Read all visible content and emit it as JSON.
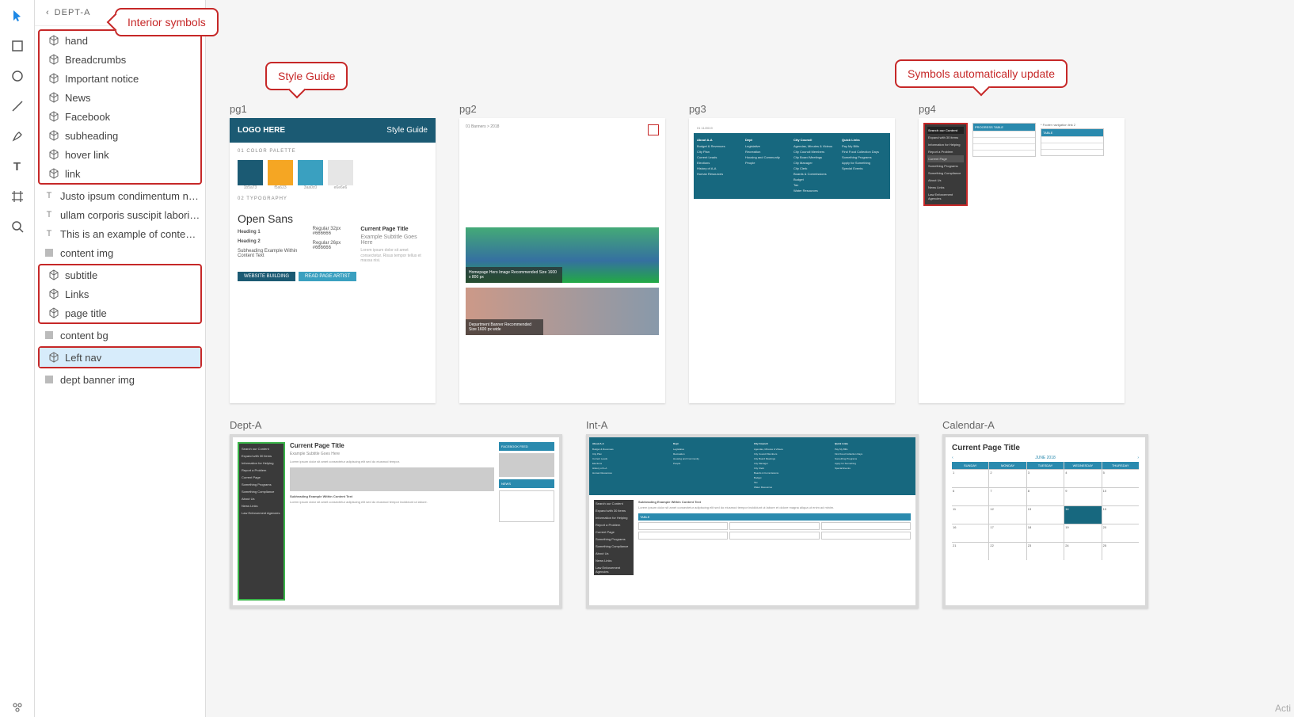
{
  "breadcrumb": {
    "back": "‹",
    "title": "DEPT-A"
  },
  "callouts": {
    "interior_symbols": "Interior symbols",
    "style_guide": "Style Guide",
    "symbols_update": "Symbols automatically update"
  },
  "toolbar": [
    {
      "name": "select-tool",
      "icon": "pointer",
      "active": true
    },
    {
      "name": "rectangle-tool",
      "icon": "square"
    },
    {
      "name": "ellipse-tool",
      "icon": "circle"
    },
    {
      "name": "line-tool",
      "icon": "line"
    },
    {
      "name": "pen-tool",
      "icon": "pen"
    },
    {
      "name": "text-tool",
      "icon": "T"
    },
    {
      "name": "artboard-tool",
      "icon": "crop"
    },
    {
      "name": "zoom-tool",
      "icon": "zoom"
    }
  ],
  "layers": [
    {
      "icon": "symbol",
      "label": "hand",
      "group": 1
    },
    {
      "icon": "symbol",
      "label": "Breadcrumbs",
      "group": 1
    },
    {
      "icon": "symbol",
      "label": "Important notice",
      "group": 1
    },
    {
      "icon": "symbol",
      "label": "News",
      "group": 1
    },
    {
      "icon": "symbol",
      "label": "Facebook",
      "group": 1
    },
    {
      "icon": "symbol",
      "label": "subheading",
      "group": 1
    },
    {
      "icon": "symbol",
      "label": "hover link",
      "group": 1
    },
    {
      "icon": "symbol",
      "label": "link",
      "group": 1
    },
    {
      "icon": "text",
      "label": "Justo ipsum condimentum nisi, i..."
    },
    {
      "icon": "text",
      "label": "ullam corporis suscipit laboriosa..."
    },
    {
      "icon": "text",
      "label": "This is an example of content tex..."
    },
    {
      "icon": "rect",
      "label": "content img"
    },
    {
      "icon": "symbol",
      "label": "subtitle",
      "group": 2
    },
    {
      "icon": "symbol",
      "label": "Links",
      "group": 2
    },
    {
      "icon": "symbol",
      "label": "page title",
      "group": 2
    },
    {
      "icon": "rect",
      "label": "content bg"
    },
    {
      "icon": "symbol",
      "label": "Left nav",
      "selected": true,
      "group": 3
    },
    {
      "icon": "rect",
      "label": "dept banner img"
    }
  ],
  "artboards": {
    "pg1": {
      "label": "pg1",
      "logo": "LOGO HERE",
      "title": "Style Guide",
      "section_palette": "01 COLOR PALETTE",
      "swatches": [
        {
          "hex": "#1b5a73"
        },
        {
          "hex": "#f5a623"
        },
        {
          "hex": "#3aa0c0"
        },
        {
          "hex": "#e6e6e6"
        }
      ],
      "section_typo": "02 TYPOGRAPHY",
      "font": "Open Sans",
      "h1": "Heading 1",
      "h1spec": "Regular 32px #666666",
      "h2": "Heading 2",
      "h2spec": "Regular 26px #666666",
      "sub": "Subheading Example Within Content Text",
      "rt_title": "Current Page Title",
      "rt_sub": "Example Subtitle Goes Here",
      "btn1": "WEBSITE BUILDING",
      "btn2": "READ PAGE ARTIST"
    },
    "pg2": {
      "label": "pg2",
      "photo1_cap": "Homepage Hero Image Recommended Size 1600 x 800 px",
      "photo2_cap": "Department Banner Recommended Size 1600 px wide"
    },
    "pg3": {
      "label": "pg3",
      "nav": {
        "cols": [
          {
            "hd": "About A-A",
            "items": [
              "Budget & Revenues",
              "City Plan",
              "Current Leads",
              "Elections",
              "History of A-A",
              "Human Resources"
            ]
          },
          {
            "hd": "Dept",
            "items": [
              "Legislative",
              "Recreation",
              "Housing and Community",
              "People"
            ]
          },
          {
            "hd": "City Council",
            "items": [
              "Agendas, Minutes & Videos",
              "City Council Members",
              "City Board Meetings",
              "City Manager",
              "City Clerk",
              "Boards & Commissions",
              "Budget",
              "Tax",
              "Water Resources"
            ]
          },
          {
            "hd": "Quick Links",
            "items": [
              "Pay My Bills",
              "Find Food Collection Days",
              "Something Programs",
              "Apply for Something",
              "Special Events"
            ]
          }
        ]
      }
    },
    "pg4": {
      "label": "pg4",
      "leftnav": [
        "Search our Content",
        "Expand with 30 items",
        "Information for Helping",
        "Report a Problem",
        "Current Page",
        "Something Programs",
        "Something Compliance",
        "About Us",
        "News Links",
        "Law Enforcement Agencies"
      ],
      "tbl_hdr": "PROGRESS TABLE",
      "table_title": "TABLE"
    },
    "deptA": {
      "label": "Dept-A",
      "title": "Current Page Title",
      "subtitle": "Example Subtitle Goes Here",
      "subhead": "Subheading Example Within Content Text",
      "fb": "FACEBOOK FEED",
      "news": "NEWS"
    },
    "intA": {
      "label": "Int-A",
      "subhead": "Subheading Example Within Content Text",
      "table": "TABLE"
    },
    "calA": {
      "label": "Calendar-A",
      "title": "Current Page Title",
      "month": "JUNE 2018",
      "days": [
        "SUNDAY",
        "MONDAY",
        "TUESDAY",
        "WEDNESDAY",
        "THURSDAY"
      ]
    }
  },
  "watermark": "Acti"
}
